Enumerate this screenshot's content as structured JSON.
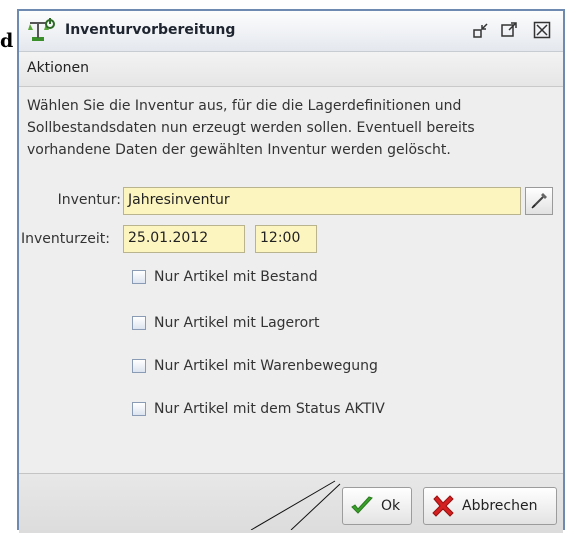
{
  "background": {
    "partial_text": "d"
  },
  "window": {
    "title": "Inventurvorbereitung",
    "menu": [
      "Aktionen"
    ],
    "description": "Wählen Sie die Inventur aus, für die die Lagerdefinitionen und Sollbestandsdaten nun erzeugt werden sollen. Eventuell bereits vorhandene Daten der gewählten Inventur werden gelöscht.",
    "inventur": {
      "label": "Inventur:",
      "value": "Jahresinventur"
    },
    "inventurzeit": {
      "label": "Inventurzeit:",
      "date": "25.01.2012",
      "time": "12:00"
    },
    "checkboxes": [
      {
        "label": "Nur Artikel mit Bestand",
        "checked": false
      },
      {
        "label": "Nur Artikel mit Lagerort",
        "checked": false
      },
      {
        "label": "Nur Artikel mit Warenbewegung",
        "checked": false
      },
      {
        "label": "Nur Artikel mit dem Status AKTIV",
        "checked": false
      }
    ],
    "buttons": {
      "ok": "Ok",
      "cancel": "Abbrechen"
    }
  },
  "colors": {
    "field_bg": "#fdf5c0",
    "window_bg": "#eeeeee",
    "border": "#6e8ab0",
    "ok_icon": "#3aa12a",
    "cancel_icon": "#d42020"
  },
  "icons": {
    "title": "scale-icon",
    "minimize": "minimize-icon",
    "maximize": "maximize-icon",
    "close": "close-icon",
    "picker": "picker-icon",
    "ok": "checkmark-icon",
    "cancel": "x-icon"
  }
}
